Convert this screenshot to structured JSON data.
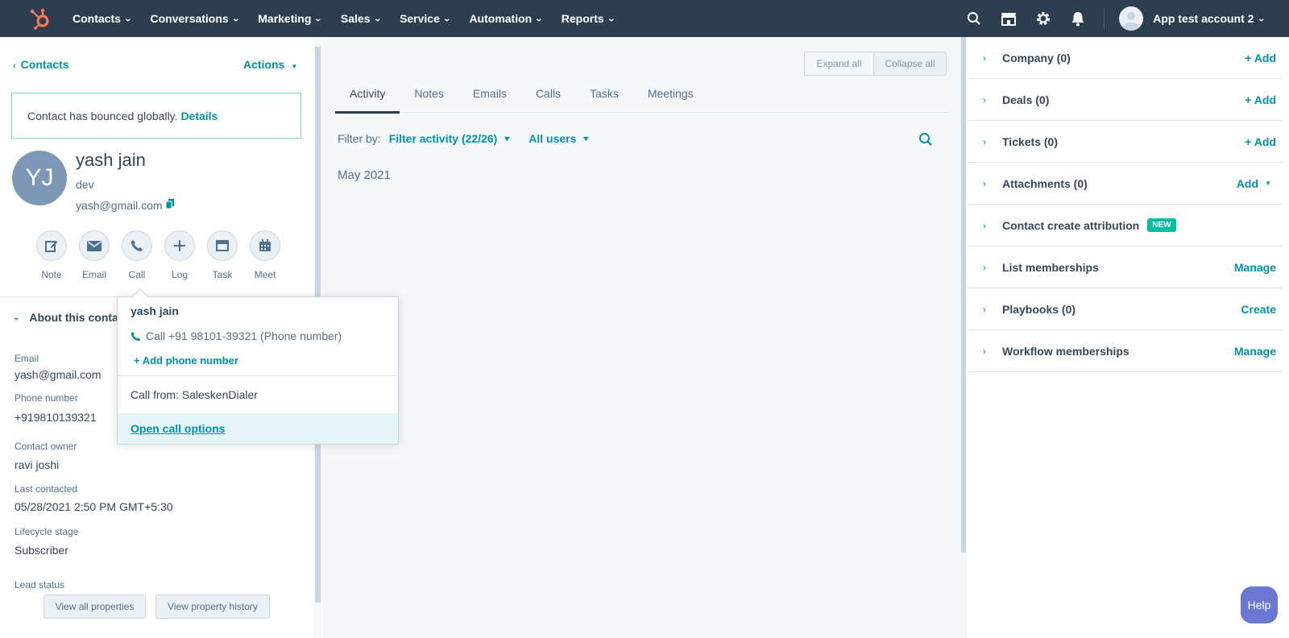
{
  "nav": {
    "items": [
      {
        "label": "Contacts"
      },
      {
        "label": "Conversations"
      },
      {
        "label": "Marketing"
      },
      {
        "label": "Sales"
      },
      {
        "label": "Service"
      },
      {
        "label": "Automation"
      },
      {
        "label": "Reports"
      }
    ],
    "account": "App test account 2",
    "brand_color": "#ff7a59",
    "bg_color": "#2d3e50"
  },
  "left": {
    "back_label": "Contacts",
    "actions_label": "Actions",
    "alert_text": "Contact has bounced globally.",
    "alert_link": "Details",
    "avatar_initials": "YJ",
    "name": "yash jain",
    "job_title": "dev",
    "email": "yash@gmail.com",
    "action_buttons": [
      {
        "label": "Note",
        "icon": "note-icon"
      },
      {
        "label": "Email",
        "icon": "email-icon"
      },
      {
        "label": "Call",
        "icon": "phone-icon"
      },
      {
        "label": "Log",
        "icon": "plus-icon"
      },
      {
        "label": "Task",
        "icon": "task-icon"
      },
      {
        "label": "Meet",
        "icon": "calendar-icon"
      }
    ],
    "about_label": "About this contact",
    "properties": [
      {
        "label": "Email",
        "value": "yash@gmail.com"
      },
      {
        "label": "Phone number",
        "value": "+919810139321"
      },
      {
        "label": "Contact owner",
        "value": "ravi joshi"
      },
      {
        "label": "Last contacted",
        "value": "05/28/2021 2:50 PM GMT+5:30"
      },
      {
        "label": "Lifecycle stage",
        "value": "Subscriber"
      },
      {
        "label": "Lead status",
        "value": ""
      }
    ],
    "view_all_label": "View all properties",
    "view_history_label": "View property history"
  },
  "middle": {
    "expand_all": "Expand all",
    "collapse_all": "Collapse all",
    "tabs": [
      {
        "label": "Activity"
      },
      {
        "label": "Notes"
      },
      {
        "label": "Emails"
      },
      {
        "label": "Calls"
      },
      {
        "label": "Tasks"
      },
      {
        "label": "Meetings"
      }
    ],
    "filter_label": "Filter by:",
    "filter_activity": "Filter activity (22/26)",
    "filter_users": "All users",
    "month": "May 2021"
  },
  "right": {
    "sections": [
      {
        "title": "Company (0)",
        "action": "+ Add"
      },
      {
        "title": "Deals (0)",
        "action": "+ Add"
      },
      {
        "title": "Tickets (0)",
        "action": "+ Add"
      },
      {
        "title": "Attachments (0)",
        "action": "Add"
      },
      {
        "title": "Contact create attribution",
        "action": "",
        "badge": "NEW"
      },
      {
        "title": "List memberships",
        "action": "Manage"
      },
      {
        "title": "Playbooks (0)",
        "action": "Create"
      },
      {
        "title": "Workflow memberships",
        "action": "Manage"
      }
    ]
  },
  "popover": {
    "name": "yash jain",
    "call_text": "Call +91 98101-39321 (Phone number)",
    "add_phone": "+ Add phone number",
    "call_from": "Call from: SaleskenDialer",
    "open_options": "Open call options"
  },
  "help_label": "Help"
}
